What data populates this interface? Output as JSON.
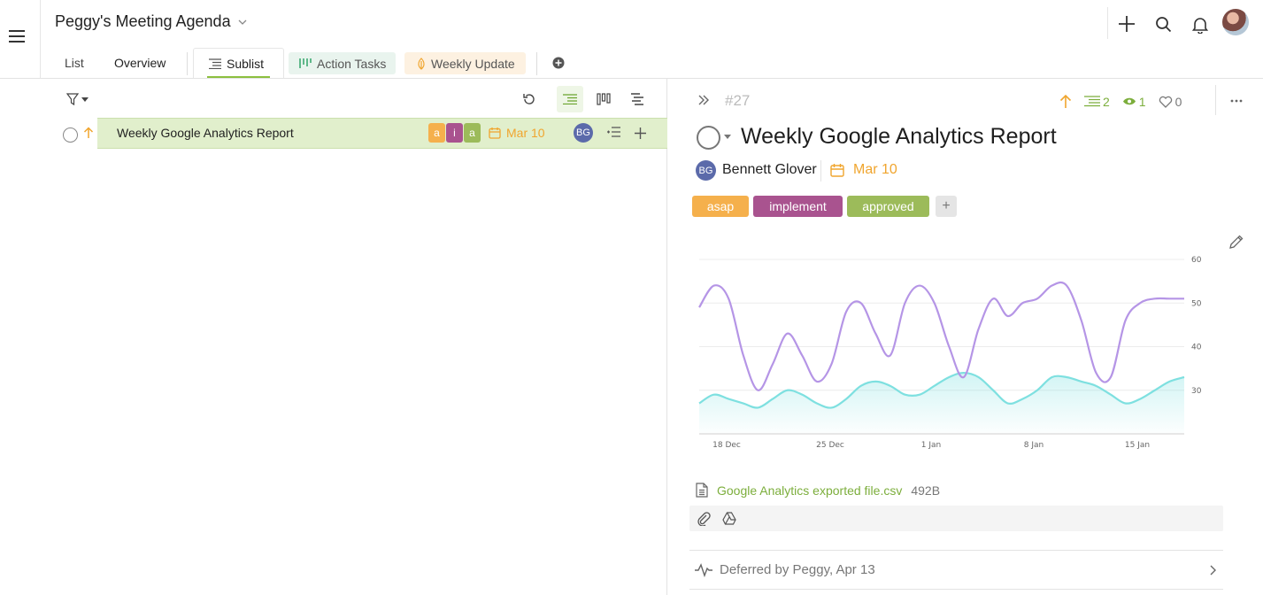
{
  "header": {
    "board_title": "Peggy's Meeting Agenda",
    "user_avatar": "user-avatar-photo"
  },
  "tabs": [
    {
      "label": "List"
    },
    {
      "label": "Overview"
    },
    {
      "label": "Sublist",
      "active": true
    },
    {
      "label": "Action Tasks"
    },
    {
      "label": "Weekly Update"
    }
  ],
  "task_row": {
    "title": "Weekly Google Analytics Report",
    "mini_tags": [
      "a",
      "i",
      "a"
    ],
    "due": "Mar 10",
    "assignee_initials": "BG"
  },
  "detail": {
    "id": "#27",
    "subtask_count": "2",
    "watcher_count": "1",
    "like_count": "0",
    "title": "Weekly Google Analytics Report",
    "owner_initials": "BG",
    "owner_name": "Bennett Glover",
    "due": "Mar 10",
    "tags": [
      {
        "label": "asap",
        "color": "#f5b04c"
      },
      {
        "label": "implement",
        "color": "#a9538f"
      },
      {
        "label": "approved",
        "color": "#9cbb5a"
      }
    ],
    "tag_add": "+",
    "attachment": {
      "name": "Google Analytics exported file.csv",
      "size": "492B"
    },
    "activity": "Deferred by Peggy, Apr 13"
  },
  "chart_data": {
    "type": "line",
    "categories": [
      "18 Dec",
      "25 Dec",
      "1 Jan",
      "8 Jan",
      "15 Jan"
    ],
    "y_ticks": [
      "60",
      "50",
      "40",
      "30"
    ],
    "ylim": [
      20,
      60
    ],
    "series": [
      {
        "color": "#b595e6",
        "x": [
          0,
          1,
          2,
          3,
          4,
          5,
          6,
          7,
          8,
          9,
          10,
          11,
          12,
          13,
          14,
          15,
          16,
          17,
          18,
          19,
          20,
          21,
          22,
          23,
          24,
          25,
          26,
          27,
          28,
          29,
          30,
          31,
          32,
          33
        ],
        "values": [
          49,
          54,
          51,
          38,
          30,
          36,
          43,
          38,
          32,
          36,
          48,
          50,
          43,
          38,
          50,
          54,
          50,
          40,
          33,
          44,
          51,
          47,
          50,
          51,
          54,
          54,
          46,
          34,
          33,
          46,
          50,
          51,
          51,
          51
        ]
      },
      {
        "color": "#7ee0e0",
        "fill": true,
        "x": [
          0,
          1,
          2,
          3,
          4,
          5,
          6,
          7,
          8,
          9,
          10,
          11,
          12,
          13,
          14,
          15,
          16,
          17,
          18,
          19,
          20,
          21,
          22,
          23,
          24,
          25,
          26,
          27,
          28,
          29,
          30,
          31,
          32,
          33
        ],
        "values": [
          27,
          29,
          28,
          27,
          26,
          28,
          30,
          29,
          27,
          26,
          28,
          31,
          32,
          31,
          29,
          29,
          31,
          33,
          34,
          33,
          30,
          27,
          28,
          30,
          33,
          33,
          32,
          31,
          29,
          27,
          28,
          30,
          32,
          33
        ]
      }
    ],
    "grid": true
  }
}
